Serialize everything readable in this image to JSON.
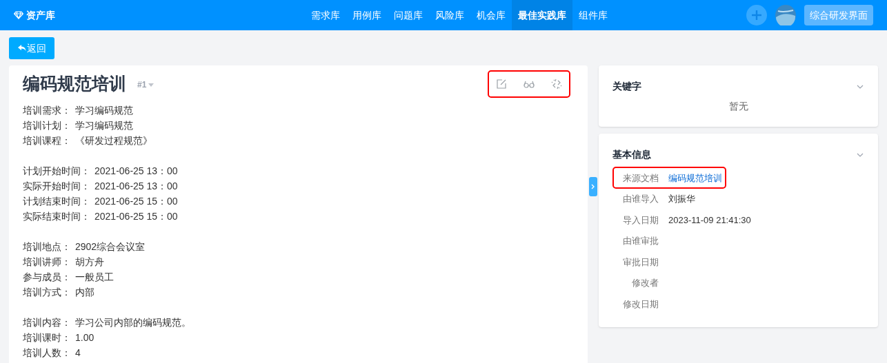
{
  "header": {
    "brand": "资产库",
    "nav": [
      {
        "label": "需求库",
        "selected": false
      },
      {
        "label": "用例库",
        "selected": false
      },
      {
        "label": "问题库",
        "selected": false
      },
      {
        "label": "风险库",
        "selected": false
      },
      {
        "label": "机会库",
        "selected": false
      },
      {
        "label": "最佳实践库",
        "selected": true
      },
      {
        "label": "组件库",
        "selected": false
      }
    ],
    "workspace_button": "综合研发界面"
  },
  "back_button": "返回",
  "document": {
    "title": "编码规范培训",
    "version": "#1",
    "toolbar_highlighted": true,
    "groups": [
      [
        {
          "label": "培训需求：",
          "value": "学习编码规范"
        },
        {
          "label": "培训计划：",
          "value": "学习编码规范"
        },
        {
          "label": "培训课程：",
          "value": "《研发过程规范》"
        }
      ],
      [
        {
          "label": "计划开始时间：",
          "value": "2021-06-25 13：00"
        },
        {
          "label": "实际开始时间：",
          "value": "2021-06-25 13：00"
        },
        {
          "label": "计划结束时间：",
          "value": "2021-06-25 15：00"
        },
        {
          "label": "实际结束时间：",
          "value": "2021-06-25 15：00"
        }
      ],
      [
        {
          "label": "培训地点：",
          "value": "2902综合会议室"
        },
        {
          "label": "培训讲师：",
          "value": "胡方舟"
        },
        {
          "label": "参与成员：",
          "value": "一般员工"
        },
        {
          "label": "培训方式：",
          "value": "内部"
        }
      ],
      [
        {
          "label": "培训内容：",
          "value": "学习公司内部的编码规范。"
        },
        {
          "label": "培训课时：",
          "value": "1.00"
        },
        {
          "label": "培训人数：",
          "value": "4"
        }
      ]
    ]
  },
  "keywords": {
    "title": "关键字",
    "empty_text": "暂无"
  },
  "basic_info": {
    "title": "基本信息",
    "rows": [
      {
        "label": "来源文档",
        "value": "编码规范培训",
        "kind": "link",
        "highlighted": true
      },
      {
        "label": "由谁导入",
        "value": "刘振华",
        "kind": "text",
        "highlighted": false
      },
      {
        "label": "导入日期",
        "value": "2023-11-09 21:41:30",
        "kind": "text",
        "highlighted": false
      },
      {
        "label": "由谁审批",
        "highlighted": false
      },
      {
        "label": "审批日期",
        "highlighted": false
      },
      {
        "label": "修改者",
        "highlighted": false
      },
      {
        "label": "修改日期",
        "highlighted": false
      }
    ]
  }
}
